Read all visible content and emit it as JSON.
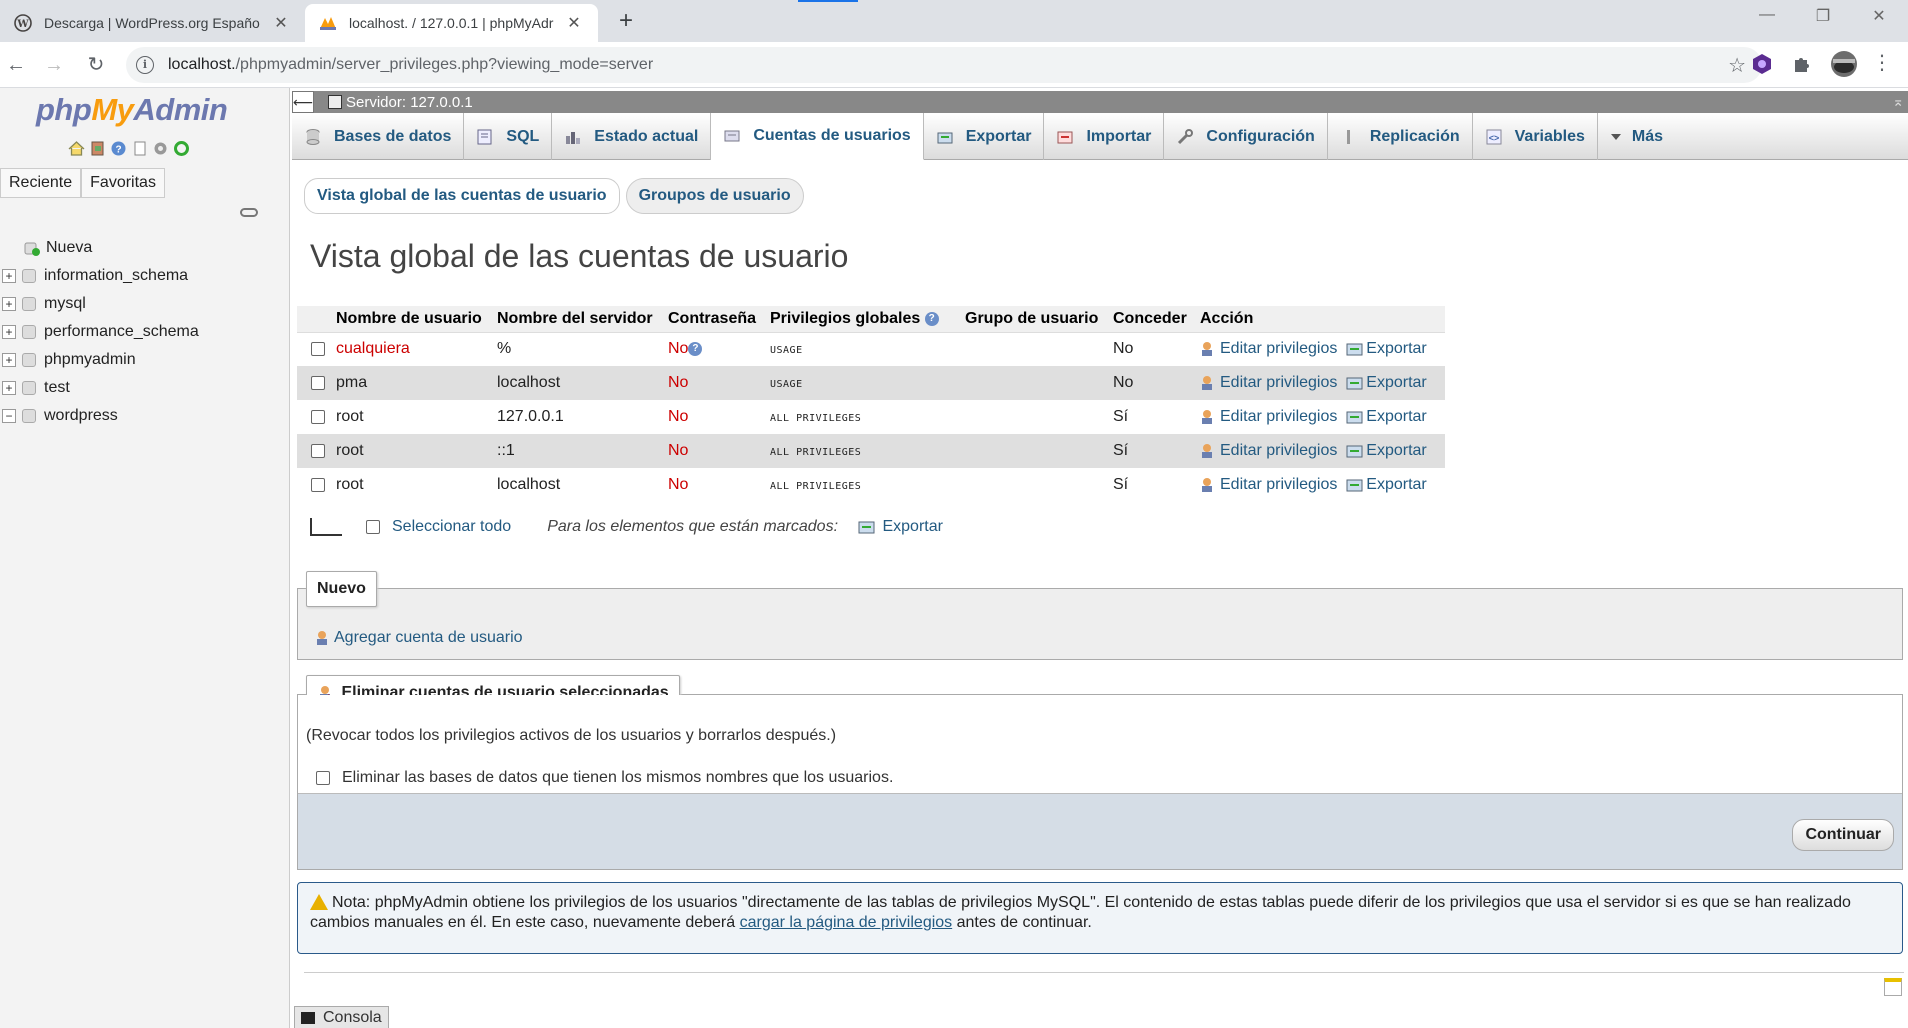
{
  "browser": {
    "tabs": [
      {
        "title": "Descarga | WordPress.org Españo",
        "favicon": "wordpress-icon",
        "active": false
      },
      {
        "title": "localhost. / 127.0.0.1 | phpMyAdr",
        "favicon": "phpmyadmin-icon",
        "active": true
      }
    ],
    "new_tab": "+",
    "close": "✕",
    "window_controls": [
      "—",
      "❐",
      "✕"
    ],
    "url_host": "localhost.",
    "url_path": "/phpmyadmin/server_privileges.php?viewing_mode=server"
  },
  "sidebar": {
    "logo": {
      "php": "php",
      "my": "My",
      "admin": "Admin"
    },
    "recent_tabs": [
      "Reciente",
      "Favoritas"
    ],
    "tree": [
      {
        "label": "Nueva",
        "type": "new"
      },
      {
        "label": "information_schema",
        "type": "db"
      },
      {
        "label": "mysql",
        "type": "db"
      },
      {
        "label": "performance_schema",
        "type": "db"
      },
      {
        "label": "phpmyadmin",
        "type": "db"
      },
      {
        "label": "test",
        "type": "db"
      },
      {
        "label": "wordpress",
        "type": "db-open"
      }
    ]
  },
  "server_bar": {
    "label": "Servidor: 127.0.0.1"
  },
  "menu": [
    {
      "label": "Bases de datos",
      "icon": "database-icon"
    },
    {
      "label": "SQL",
      "icon": "sql-icon"
    },
    {
      "label": "Estado actual",
      "icon": "status-icon"
    },
    {
      "label": "Cuentas de usuarios",
      "icon": "users-icon",
      "active": true
    },
    {
      "label": "Exportar",
      "icon": "export-icon"
    },
    {
      "label": "Importar",
      "icon": "import-icon"
    },
    {
      "label": "Configuración",
      "icon": "wrench-icon"
    },
    {
      "label": "Replicación",
      "icon": "replication-icon"
    },
    {
      "label": "Variables",
      "icon": "variables-icon"
    },
    {
      "label": "Más",
      "icon": "chevron-down-icon"
    }
  ],
  "subnav": [
    "Vista global de las cuentas de usuario",
    "Groupos de usuario"
  ],
  "page_title": "Vista global de las cuentas de usuario",
  "table": {
    "headers": [
      "Nombre de usuario",
      "Nombre del servidor",
      "Contraseña",
      "Privilegios globales",
      "Grupo de usuario",
      "Conceder",
      "Acción"
    ],
    "rows": [
      {
        "user": "cualquiera",
        "host": "%",
        "password": "No",
        "privileges": "USAGE",
        "group": "",
        "grant": "No",
        "edit": "Editar privilegios",
        "export": "Exportar"
      },
      {
        "user": "pma",
        "host": "localhost",
        "password": "No",
        "privileges": "USAGE",
        "group": "",
        "grant": "No",
        "edit": "Editar privilegios",
        "export": "Exportar"
      },
      {
        "user": "root",
        "host": "127.0.0.1",
        "password": "No",
        "privileges": "ALL PRIVILEGES",
        "group": "",
        "grant": "Sí",
        "edit": "Editar privilegios",
        "export": "Exportar"
      },
      {
        "user": "root",
        "host": "::1",
        "password": "No",
        "privileges": "ALL PRIVILEGES",
        "group": "",
        "grant": "Sí",
        "edit": "Editar privilegios",
        "export": "Exportar"
      },
      {
        "user": "root",
        "host": "localhost",
        "password": "No",
        "privileges": "ALL PRIVILEGES",
        "group": "",
        "grant": "Sí",
        "edit": "Editar privilegios",
        "export": "Exportar"
      }
    ]
  },
  "bulk": {
    "select_all": "Seleccionar todo",
    "marked": "Para los elementos que están marcados:",
    "export": "Exportar"
  },
  "new_section": {
    "legend": "Nuevo",
    "add_link": "Agregar cuenta de usuario"
  },
  "delete_section": {
    "legend": "Eliminar cuentas de usuario seleccionadas",
    "description": "(Revocar todos los privilegios activos de los usuarios y borrarlos después.)",
    "drop_db_label": "Eliminar las bases de datos que tienen los mismos nombres que los usuarios.",
    "submit": "Continuar"
  },
  "note": {
    "text_before": "Nota: phpMyAdmin obtiene los privilegios de los usuarios \"directamente de las tablas de privilegios MySQL\". El contenido de estas tablas puede diferir de los privilegios que usa el servidor si es que se han realizado cambios manuales en él. En este caso, nuevamente deberá ",
    "link": "cargar la página de privilegios",
    "text_after": " antes de continuar."
  },
  "console": {
    "label": "Consola"
  }
}
